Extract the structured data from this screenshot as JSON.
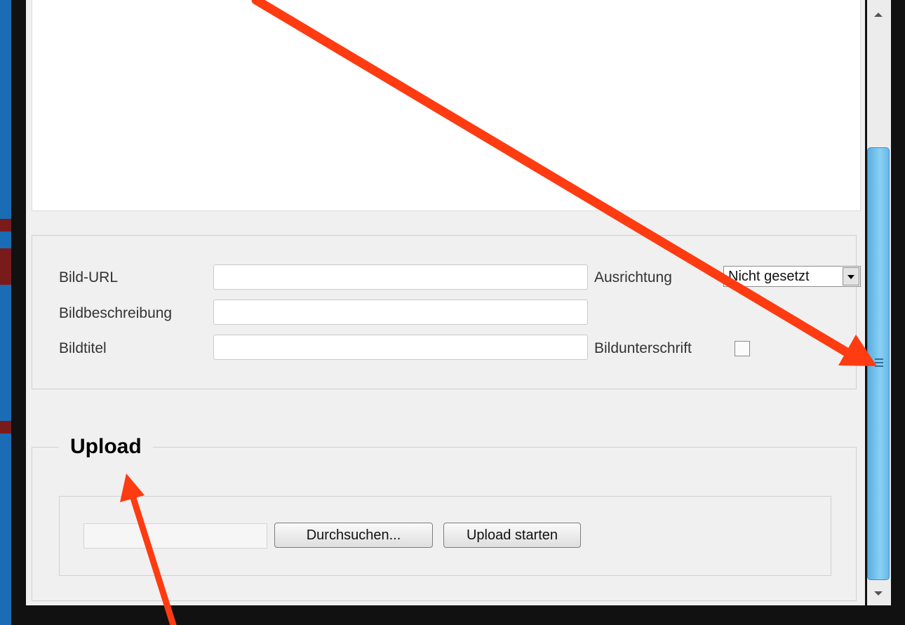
{
  "image_form": {
    "url_label": "Bild-URL",
    "url_value": "",
    "description_label": "Bildbeschreibung",
    "description_value": "",
    "title_label": "Bildtitel",
    "title_value": "",
    "alignment_label": "Ausrichtung",
    "alignment_selected": "Nicht gesetzt",
    "caption_label": "Bildunterschrift",
    "caption_checked": false
  },
  "upload": {
    "legend": "Upload",
    "browse_label": "Durchsuchen...",
    "start_label": "Upload starten"
  },
  "annotations": {
    "arrow_color": "#ff3b12"
  },
  "icons": [
    "dropdown-arrow-icon",
    "scroll-up-icon",
    "scroll-down-icon",
    "scroll-grip-icon"
  ]
}
